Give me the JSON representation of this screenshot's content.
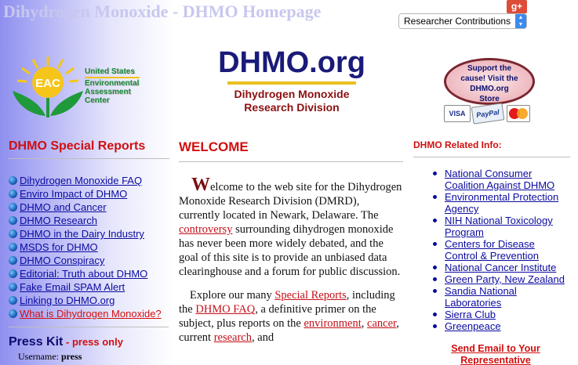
{
  "header": {
    "site_title": "Dihydrogen Monoxide - DHMO Homepage",
    "gplus_label": "g+",
    "dropdown_selected": "Researcher Contributions"
  },
  "eac": {
    "logo_text": "EAC",
    "line1": "United States",
    "line2": "Environmental",
    "line3": "Assessment",
    "line4": "Center"
  },
  "logo": {
    "title": "DHMO.org",
    "subtitle_line1": "Dihydrogen Monoxide",
    "subtitle_line2": "Research Division"
  },
  "store": {
    "line1": "Support the",
    "line2": "cause! Visit the",
    "line3": "DHMO.org",
    "line4": "Store",
    "cards": [
      "VISA",
      "PayPal",
      "MasterCard"
    ]
  },
  "left": {
    "heading": "DHMO Special Reports",
    "reports": [
      "Dihydrogen Monoxide FAQ",
      "Enviro Impact of DHMO",
      "DHMO and Cancer",
      "DHMO Research",
      "DHMO in the Dairy Industry",
      "MSDS for DHMO",
      "DHMO Conspiracy",
      "Editorial: Truth about DHMO",
      "Fake Email SPAM Alert",
      "Linking to DHMO.org",
      "What is Dihydrogen Monoxide?"
    ],
    "presskit_title": "Press Kit",
    "presskit_dash": " - ",
    "presskit_note": "press only",
    "username_label": "Username:",
    "username_value": "press"
  },
  "center": {
    "heading": "WELCOME",
    "p1_dropcap": "W",
    "p1_text": "elcome to the web site for the Dihydrogen Monoxide Research Division (DMRD), currently located in Newark, Delaware. The ",
    "p1_link": "controversy",
    "p1_text2": " surrounding dihydrogen monoxide has never been more widely debated, and the goal of this site is to provide an unbiased data clearinghouse and a forum for public discussion.",
    "p2_text1": "Explore our many ",
    "p2_link1": "Special Reports",
    "p2_text2": ", including the ",
    "p2_link2": "DHMO FAQ",
    "p2_text3": ", a definitive primer on the subject, plus reports on the ",
    "p2_link3": "environment",
    "p2_text4": ", ",
    "p2_link4": "cancer",
    "p2_text5": ", current ",
    "p2_link5": "research",
    "p2_text6": ", and"
  },
  "right": {
    "heading": "DHMO Related Info:",
    "links": [
      "National Consumer Coalition Against DHMO",
      "Environmental Protection Agency",
      "NIH National Toxicology Program",
      "Centers for Disease Control & Prevention",
      "National Cancer Institute",
      "Green Party, New Zealand",
      "Sandia National Laboratories",
      "Sierra Club",
      "Greenpeace"
    ],
    "send_email": "Send Email to Your Representative"
  }
}
